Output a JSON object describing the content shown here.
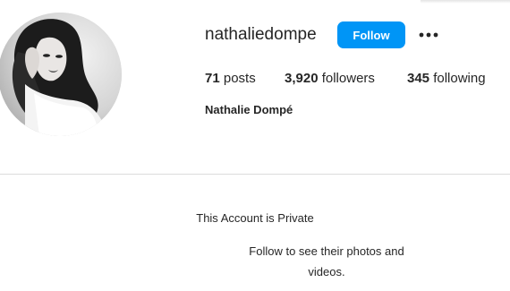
{
  "profile": {
    "username": "nathaliedompe",
    "full_name": "Nathalie Dompé",
    "follow_label": "Follow",
    "more_icon": "ellipsis-icon",
    "avatar_description": "profile-photo"
  },
  "stats": {
    "posts_count": "71",
    "posts_label": " posts",
    "followers_count": "3,920",
    "followers_label": " followers",
    "following_count": "345",
    "following_label": " following"
  },
  "private_notice": {
    "title": "This Account is Private",
    "subtitle": "Follow to see their photos and videos."
  },
  "colors": {
    "accent": "#0095f6",
    "text": "#262626",
    "divider": "#dbdbdb"
  }
}
